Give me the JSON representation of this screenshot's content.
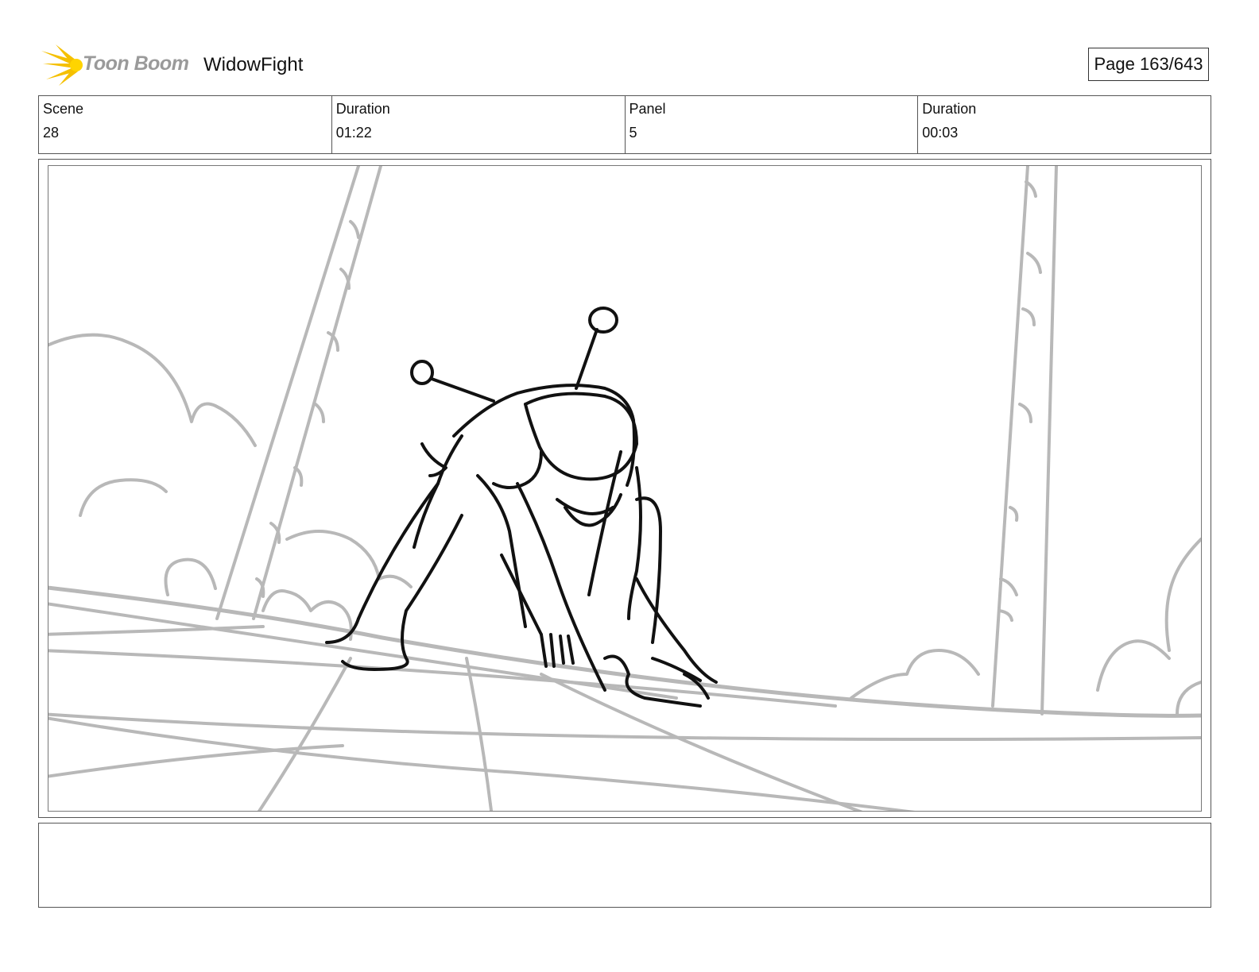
{
  "header": {
    "logo_text": "Toon Boom",
    "project_title": "WidowFight",
    "page_label": "Page 163/643"
  },
  "meta": {
    "scene_label": "Scene",
    "scene_value": "28",
    "scene_duration_label": "Duration",
    "scene_duration_value": "01:22",
    "panel_label": "Panel",
    "panel_value": "5",
    "panel_duration_label": "Duration",
    "panel_duration_value": "00:03"
  },
  "notes": {
    "text": ""
  },
  "colors": {
    "logo_burst": "#f5c000",
    "logo_text": "#9a9a9a",
    "sketch_background": "#b8b8b8",
    "sketch_character": "#111111"
  }
}
